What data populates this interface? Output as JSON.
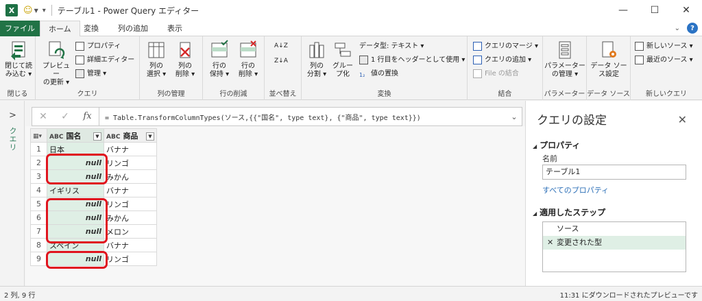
{
  "window": {
    "title": "テーブル1 - Power Query エディター",
    "minimize": "—",
    "maximize": "☐",
    "close": "✕"
  },
  "tabs": [
    {
      "label": "ファイル"
    },
    {
      "label": "ホーム"
    },
    {
      "label": "変換"
    },
    {
      "label": "列の追加"
    },
    {
      "label": "表示"
    }
  ],
  "ribbon": {
    "groups": {
      "close": "閉じる",
      "query": "クエリ",
      "manage_cols": "列の管理",
      "reduce_rows": "行の削減",
      "sort": "並べ替え",
      "transform": "変換",
      "combine": "結合",
      "params": "パラメーター",
      "datasource": "データ ソース",
      "newquery": "新しいクエリ"
    },
    "buttons": {
      "close_load_1": "閉じて読",
      "close_load_2": "み込む ▾",
      "preview_1": "プレビュー",
      "preview_2": "の更新 ▾",
      "properties": "プロパティ",
      "advanced_editor": "詳細エディター",
      "manage": "管理 ▾",
      "choose_cols_1": "列の",
      "choose_cols_2": "選択 ▾",
      "remove_cols_1": "列の",
      "remove_cols_2": "削除 ▾",
      "keep_rows_1": "行の",
      "keep_rows_2": "保持 ▾",
      "remove_rows_1": "行の",
      "remove_rows_2": "削除 ▾",
      "split_1": "列の",
      "split_2": "分割 ▾",
      "group_1": "グルー",
      "group_2": "プ化",
      "datatype": "データ型: テキスト ▾",
      "first_row_header": "1 行目をヘッダーとして使用 ▾",
      "replace_values": "値の置換",
      "merge_queries": "クエリのマージ ▾",
      "append_queries": "クエリの追加 ▾",
      "combine_files": "File の結合",
      "manage_params_1": "パラメーター",
      "manage_params_2": "の管理 ▾",
      "ds_settings_1": "データ ソー",
      "ds_settings_2": "ス設定",
      "new_source": "新しいソース ▾",
      "recent_sources": "最近のソース ▾"
    }
  },
  "leftnav": {
    "label": "クエリ"
  },
  "formula": {
    "fx": "fx",
    "text": "= Table.TransformColumnTypes(ソース,{{\"国名\", type text}, {\"商品\", type text}})"
  },
  "grid": {
    "type_icon": "ABC",
    "headers": [
      "国名",
      "商品"
    ],
    "rows": [
      {
        "n": "1",
        "country": "日本",
        "product": "バナナ"
      },
      {
        "n": "2",
        "country": "null",
        "product": "リンゴ"
      },
      {
        "n": "3",
        "country": "null",
        "product": "みかん"
      },
      {
        "n": "4",
        "country": "イギリス",
        "product": "バナナ"
      },
      {
        "n": "5",
        "country": "null",
        "product": "リンゴ"
      },
      {
        "n": "6",
        "country": "null",
        "product": "みかん"
      },
      {
        "n": "7",
        "country": "null",
        "product": "メロン"
      },
      {
        "n": "8",
        "country": "スペイン",
        "product": "バナナ"
      },
      {
        "n": "9",
        "country": "null",
        "product": "リンゴ"
      }
    ]
  },
  "settings": {
    "title": "クエリの設定",
    "properties_title": "プロパティ",
    "name_label": "名前",
    "name_value": "テーブル1",
    "all_properties": "すべてのプロパティ",
    "steps_title": "適用したステップ",
    "steps": [
      "ソース",
      "変更された型"
    ]
  },
  "status": {
    "left": "2 列, 9 行",
    "right": "11:31 にダウンロードされたプレビューです"
  },
  "colors": {
    "excel_green": "#217346",
    "highlight_red": "#e0141e",
    "selected_green": "#dfefe5",
    "link_blue": "#2c6fb7"
  }
}
